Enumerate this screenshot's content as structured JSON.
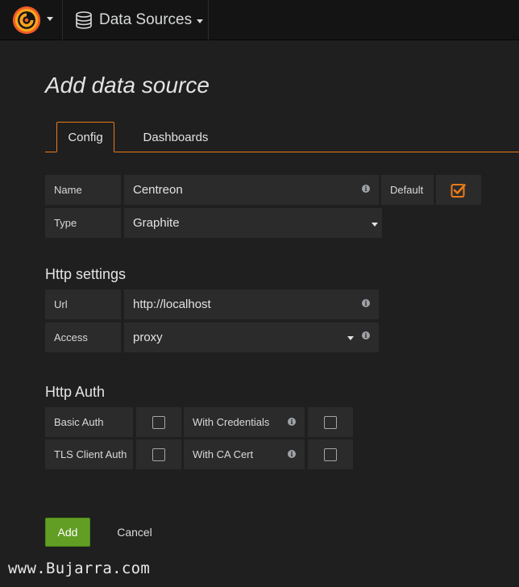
{
  "navbar": {
    "section_title": "Data Sources"
  },
  "page": {
    "title": "Add data source"
  },
  "tabs": [
    {
      "label": "Config",
      "active": true
    },
    {
      "label": "Dashboards",
      "active": false
    }
  ],
  "form": {
    "name_label": "Name",
    "name_value": "Centreon",
    "default_label": "Default",
    "default_checked": true,
    "type_label": "Type",
    "type_value": "Graphite"
  },
  "http_settings": {
    "heading": "Http settings",
    "url_label": "Url",
    "url_value": "http://localhost",
    "access_label": "Access",
    "access_value": "proxy"
  },
  "http_auth": {
    "heading": "Http Auth",
    "basic_auth_label": "Basic Auth",
    "basic_auth_checked": false,
    "with_credentials_label": "With Credentials",
    "with_credentials_checked": false,
    "tls_client_auth_label": "TLS Client Auth",
    "tls_client_auth_checked": false,
    "with_ca_cert_label": "With CA Cert",
    "with_ca_cert_checked": false
  },
  "actions": {
    "add_label": "Add",
    "cancel_label": "Cancel"
  },
  "watermark": "www.Bujarra.com",
  "colors": {
    "accent_orange": "#eb7b18",
    "success_green": "#629e24",
    "background": "#1f1f20",
    "navbar": "#141414",
    "input_bg": "#2b2b2c"
  },
  "icons": {
    "logo": "grafana-logo-icon",
    "section": "database-icon",
    "info": "info-icon",
    "checkbox_checked": "checkbox-checked-icon"
  }
}
